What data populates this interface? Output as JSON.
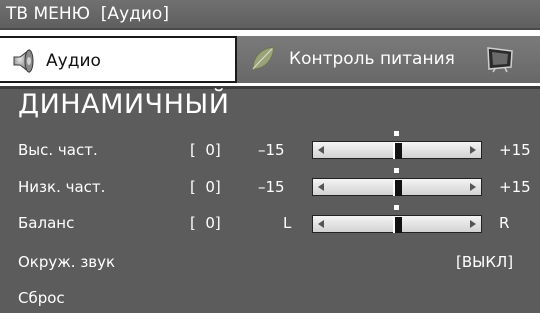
{
  "header": {
    "title": "ТВ МЕНЮ  [Аудио]"
  },
  "tabs": {
    "audio": {
      "label": "Аудио",
      "icon": "speaker-icon"
    },
    "power": {
      "label": "Контроль питания",
      "icon": "leaf-icon",
      "tv_icon": "tv-icon"
    }
  },
  "panel": {
    "mode": "ДИНАМИЧНЫЙ",
    "rows": [
      {
        "label": "Выс. част.",
        "value": "[  0]",
        "min": "–15",
        "max": "+15",
        "level": 0.5
      },
      {
        "label": "Низк. част.",
        "value": "[  0]",
        "min": "–15",
        "max": "+15",
        "level": 0.5
      },
      {
        "label": "Баланс",
        "value": "[  0]",
        "min": "L",
        "max": "R",
        "level": 0.5
      }
    ],
    "surround": {
      "label": "Окруж. звук",
      "value": "[ВЫКЛ]"
    },
    "reset": {
      "label": "Сброс"
    }
  },
  "colors": {
    "header_bg": "#666666",
    "panel_bg": "#5c5c5c",
    "active_tab_bg": "#ffffff",
    "inactive_tab_bg": "#707070"
  }
}
